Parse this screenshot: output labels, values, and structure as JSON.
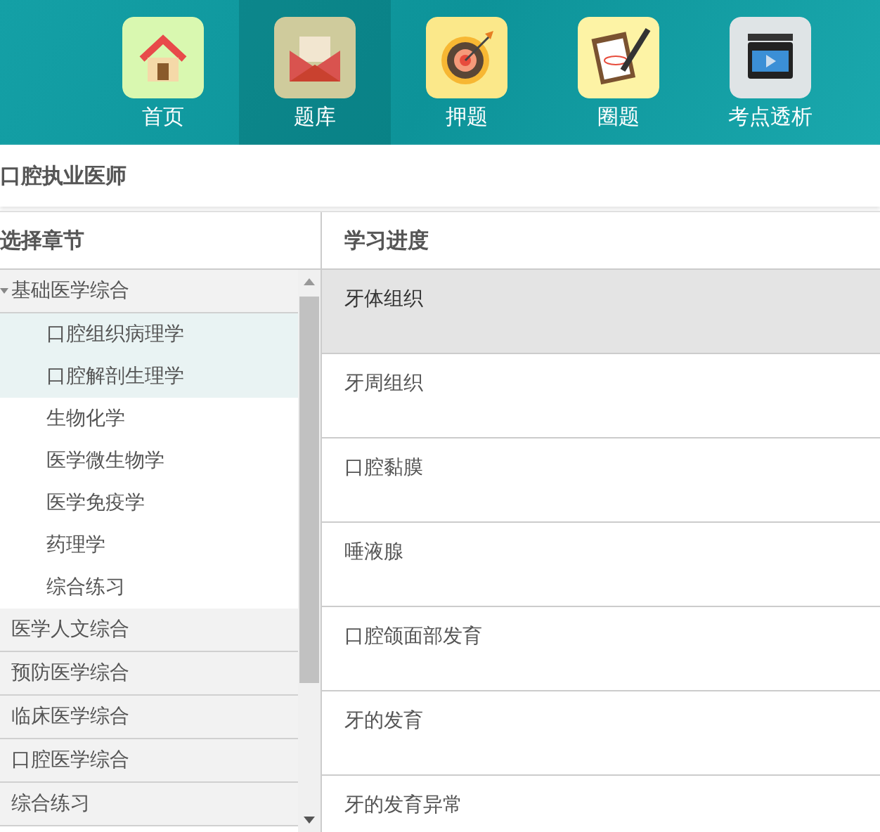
{
  "nav": [
    {
      "label": "首页",
      "kind": "home",
      "selected": false
    },
    {
      "label": "题库",
      "kind": "mail",
      "selected": true
    },
    {
      "label": "押题",
      "kind": "target",
      "selected": false
    },
    {
      "label": "圈题",
      "kind": "clipboard",
      "selected": false
    },
    {
      "label": "考点透析",
      "kind": "video",
      "selected": false
    }
  ],
  "page_title": "口腔执业医师",
  "chapters": {
    "header": "选择章节",
    "groups": [
      {
        "label": "基础医学综合",
        "expanded": true,
        "children": [
          {
            "label": "口腔组织病理学",
            "selected": true
          },
          {
            "label": "口腔解剖生理学",
            "selected": true
          },
          {
            "label": "生物化学",
            "selected": false
          },
          {
            "label": "医学微生物学",
            "selected": false
          },
          {
            "label": "医学免疫学",
            "selected": false
          },
          {
            "label": "药理学",
            "selected": false
          },
          {
            "label": "综合练习",
            "selected": false
          }
        ]
      },
      {
        "label": "医学人文综合",
        "expanded": false
      },
      {
        "label": "预防医学综合",
        "expanded": false
      },
      {
        "label": "临床医学综合",
        "expanded": false
      },
      {
        "label": "口腔医学综合",
        "expanded": false
      },
      {
        "label": "综合练习",
        "expanded": false
      }
    ]
  },
  "progress": {
    "header": "学习进度",
    "rows": [
      {
        "label": "牙体组织",
        "selected": true
      },
      {
        "label": "牙周组织",
        "selected": false
      },
      {
        "label": "口腔黏膜",
        "selected": false
      },
      {
        "label": "唾液腺",
        "selected": false
      },
      {
        "label": "口腔颌面部发育",
        "selected": false
      },
      {
        "label": "牙的发育",
        "selected": false
      },
      {
        "label": "牙的发育异常",
        "selected": false
      }
    ]
  }
}
